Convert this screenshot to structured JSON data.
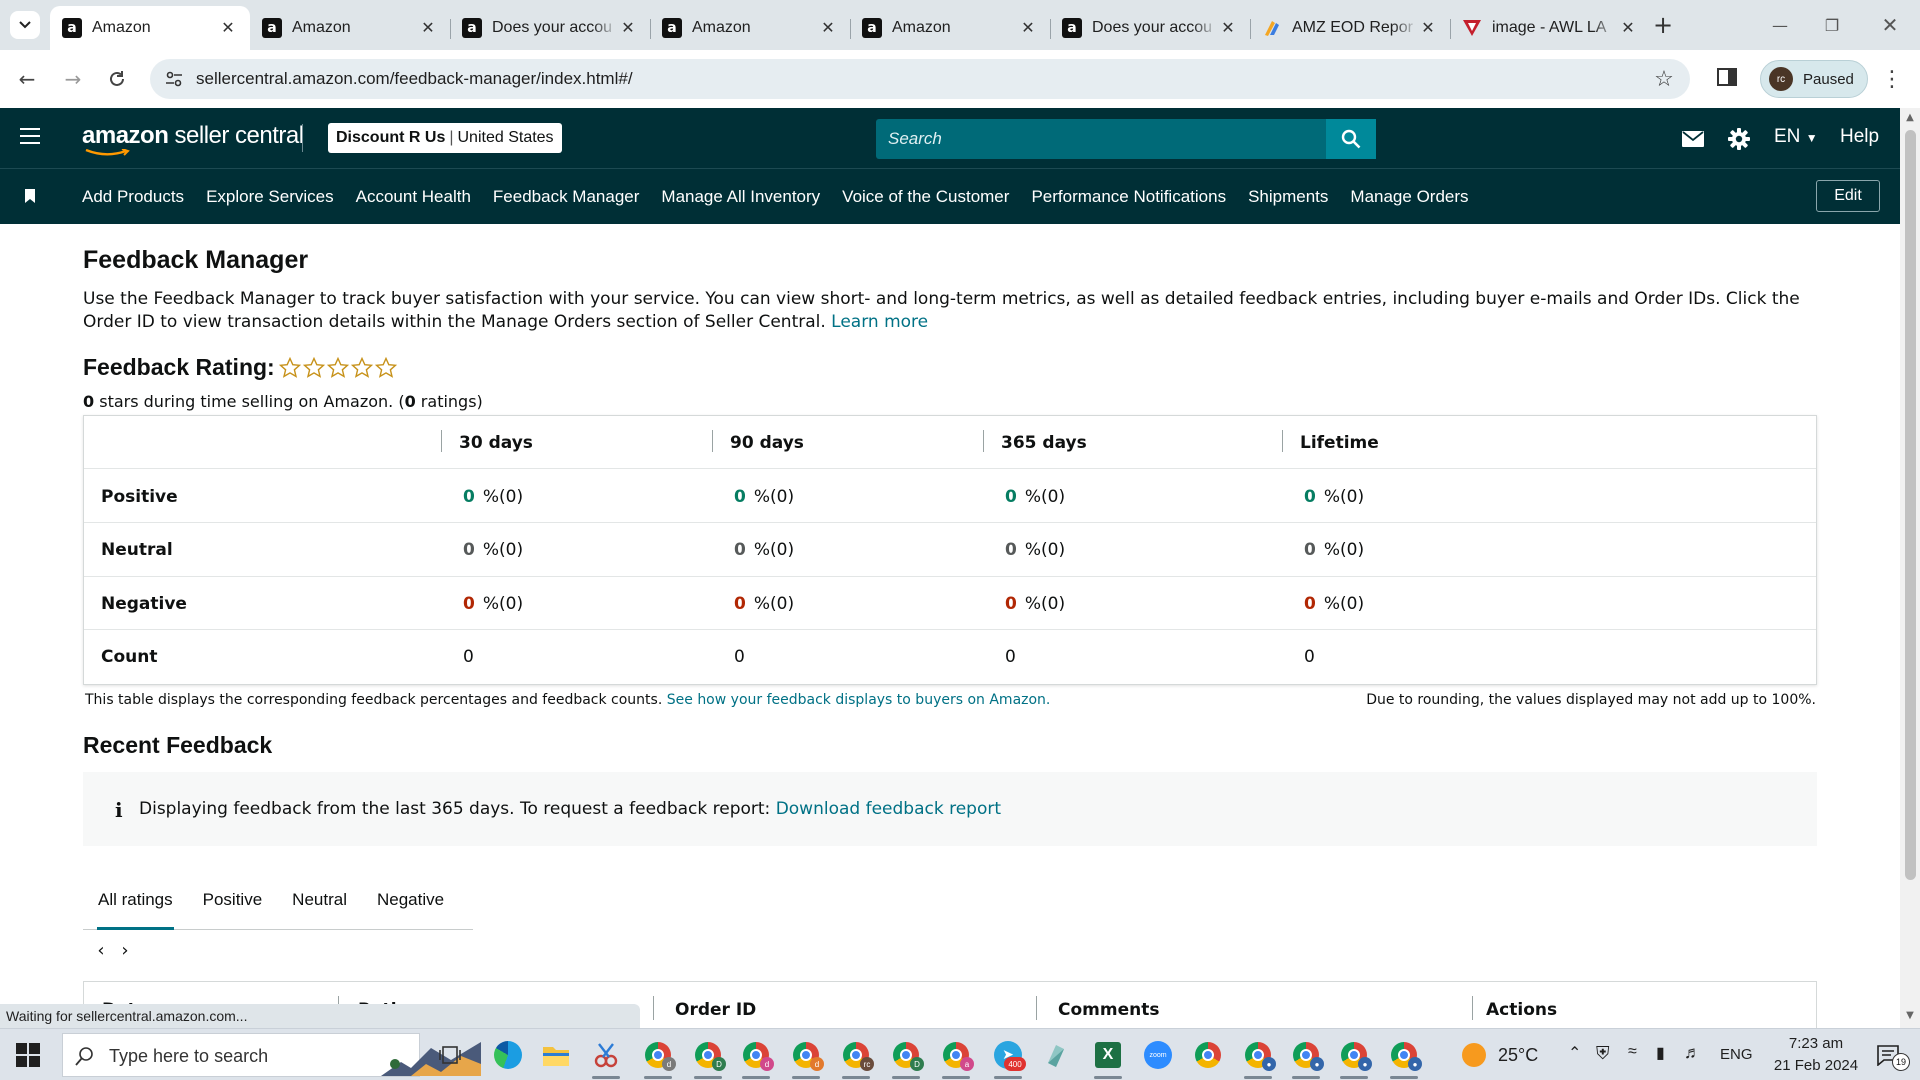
{
  "browser": {
    "tabs": [
      {
        "title": "Amazon",
        "favicon": "amazon-icon",
        "active": true
      },
      {
        "title": "Amazon",
        "favicon": "amazon-icon",
        "active": false
      },
      {
        "title": "Does your accou",
        "favicon": "amazon-icon",
        "active": false
      },
      {
        "title": "Amazon",
        "favicon": "amazon-icon",
        "active": false
      },
      {
        "title": "Amazon",
        "favicon": "amazon-icon",
        "active": false
      },
      {
        "title": "Does your accou",
        "favicon": "amazon-icon",
        "active": false
      },
      {
        "title": "AMZ EOD Repor",
        "favicon": "sheets-icon",
        "active": false
      },
      {
        "title": "image - AWL LA",
        "favicon": "awl-icon",
        "active": false
      }
    ],
    "url": "sellercentral.amazon.com/feedback-manager/index.html#/",
    "profile": {
      "initials": "rc",
      "status": "Paused"
    },
    "status_bar": "Waiting for sellercentral.amazon.com..."
  },
  "header": {
    "logo_bold": "amazon",
    "logo_rest": " seller central",
    "store_name": "Discount R Us",
    "store_separator": "|",
    "marketplace": "United States",
    "search_placeholder": "Search",
    "language": "EN",
    "help": "Help"
  },
  "nav": {
    "links": [
      "Add Products",
      "Explore Services",
      "Account Health",
      "Feedback Manager",
      "Manage All Inventory",
      "Voice of the Customer",
      "Performance Notifications",
      "Shipments",
      "Manage Orders"
    ],
    "edit": "Edit"
  },
  "page": {
    "title": "Feedback Manager",
    "intro": "Use the Feedback Manager to track buyer satisfaction with your service. You can view short- and long-term metrics, as well as detailed feedback entries, including buyer e-mails and Order IDs. Click the Order ID to view transaction details within the Manage Orders section of Seller Central.",
    "learn_more": "Learn more",
    "rating_title": "Feedback Rating:",
    "rating_stars": 0,
    "rating_max": 5,
    "rating_value": "0",
    "rating_text_mid": " stars during time selling on Amazon. (",
    "rating_count": "0",
    "rating_text_end": " ratings)"
  },
  "metrics": {
    "columns": [
      "30 days",
      "90 days",
      "365 days",
      "Lifetime"
    ],
    "rows": [
      {
        "label": "Positive",
        "kind": "pos",
        "cells": [
          {
            "pct": "0",
            "count": "%(0)"
          },
          {
            "pct": "0",
            "count": "%(0)"
          },
          {
            "pct": "0",
            "count": "%(0)"
          },
          {
            "pct": "0",
            "count": "%(0)"
          }
        ]
      },
      {
        "label": "Neutral",
        "kind": "neu",
        "cells": [
          {
            "pct": "0",
            "count": "%(0)"
          },
          {
            "pct": "0",
            "count": "%(0)"
          },
          {
            "pct": "0",
            "count": "%(0)"
          },
          {
            "pct": "0",
            "count": "%(0)"
          }
        ]
      },
      {
        "label": "Negative",
        "kind": "neg",
        "cells": [
          {
            "pct": "0",
            "count": "%(0)"
          },
          {
            "pct": "0",
            "count": "%(0)"
          },
          {
            "pct": "0",
            "count": "%(0)"
          },
          {
            "pct": "0",
            "count": "%(0)"
          }
        ]
      },
      {
        "label": "Count",
        "kind": "count",
        "cells": [
          {
            "pct": "",
            "count": "0"
          },
          {
            "pct": "",
            "count": "0"
          },
          {
            "pct": "",
            "count": "0"
          },
          {
            "pct": "",
            "count": "0"
          }
        ]
      }
    ],
    "note": "This table displays the corresponding feedback percentages and feedback counts.",
    "note_link": "See how your feedback displays to buyers on Amazon.",
    "note_right": "Due to rounding, the values displayed may not add up to 100%."
  },
  "recent": {
    "title": "Recent Feedback",
    "info_icon": "i",
    "info_text": "Displaying feedback from the last 365 days. To request a feedback report:",
    "info_link": "Download feedback report",
    "filter_tabs": [
      "All ratings",
      "Positive",
      "Neutral",
      "Negative"
    ],
    "active_filter": 0,
    "table_headers": [
      "Date",
      "Rating",
      "Order ID",
      "Comments",
      "Actions"
    ]
  },
  "taskbar": {
    "search_placeholder": "Type here to search",
    "weather": "25°C",
    "language": "ENG",
    "time": "7:23 am",
    "date": "21 Feb 2024",
    "notifications": "19",
    "telegram_badge": "400"
  },
  "colors": {
    "header_bg": "#002f36",
    "link": "#007185",
    "positive": "#067d62",
    "negative": "#b12704",
    "star": "#c7921a"
  }
}
